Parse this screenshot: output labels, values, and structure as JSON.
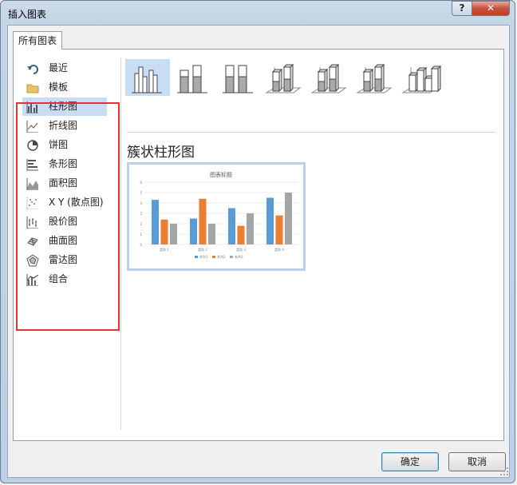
{
  "window": {
    "title": "插入图表",
    "help_label": "?",
    "close_label": "✕"
  },
  "tabs": [
    {
      "label": "所有图表"
    }
  ],
  "categories": [
    {
      "label": "最近",
      "icon": "undo-arrow-icon"
    },
    {
      "label": "模板",
      "icon": "folder-icon"
    },
    {
      "label": "柱形图",
      "icon": "column-chart-icon",
      "selected": true
    },
    {
      "label": "折线图",
      "icon": "line-chart-icon"
    },
    {
      "label": "饼图",
      "icon": "pie-chart-icon"
    },
    {
      "label": "条形图",
      "icon": "bar-chart-icon"
    },
    {
      "label": "面积图",
      "icon": "area-chart-icon"
    },
    {
      "label": "X Y (散点图)",
      "icon": "scatter-chart-icon"
    },
    {
      "label": "股价图",
      "icon": "stock-chart-icon"
    },
    {
      "label": "曲面图",
      "icon": "surface-chart-icon"
    },
    {
      "label": "雷达图",
      "icon": "radar-chart-icon"
    },
    {
      "label": "组合",
      "icon": "combo-chart-icon"
    }
  ],
  "chart_subtypes": [
    {
      "icon": "clustered-column-icon",
      "selected": true
    },
    {
      "icon": "stacked-column-icon"
    },
    {
      "icon": "percent-stacked-column-icon"
    },
    {
      "icon": "3d-clustered-column-icon"
    },
    {
      "icon": "3d-stacked-column-icon"
    },
    {
      "icon": "3d-percent-stacked-column-icon"
    },
    {
      "icon": "3d-column-icon"
    }
  ],
  "selected_type_title": "簇状柱形图",
  "chart_data": {
    "type": "bar",
    "title": "图表标题",
    "categories": [
      "类别 1",
      "类别 2",
      "类别 3",
      "类别 4"
    ],
    "series": [
      {
        "name": "系列1",
        "values": [
          4.3,
          2.5,
          3.5,
          4.5
        ],
        "color": "#5b9bd5"
      },
      {
        "name": "系列2",
        "values": [
          2.4,
          4.4,
          1.8,
          2.8
        ],
        "color": "#ed7d31"
      },
      {
        "name": "系列3",
        "values": [
          2.0,
          2.0,
          3.0,
          5.0
        ],
        "color": "#a5a5a5"
      }
    ],
    "ylim": [
      0,
      6
    ],
    "y_ticks": [
      "0",
      "1",
      "2",
      "3",
      "4",
      "5",
      "6"
    ],
    "grid": true,
    "legend_position": "bottom"
  },
  "buttons": {
    "ok": "确定",
    "cancel": "取消"
  },
  "colors": {
    "accent_selected": "#c8dcf4",
    "highlight_box": "#e8303b"
  }
}
